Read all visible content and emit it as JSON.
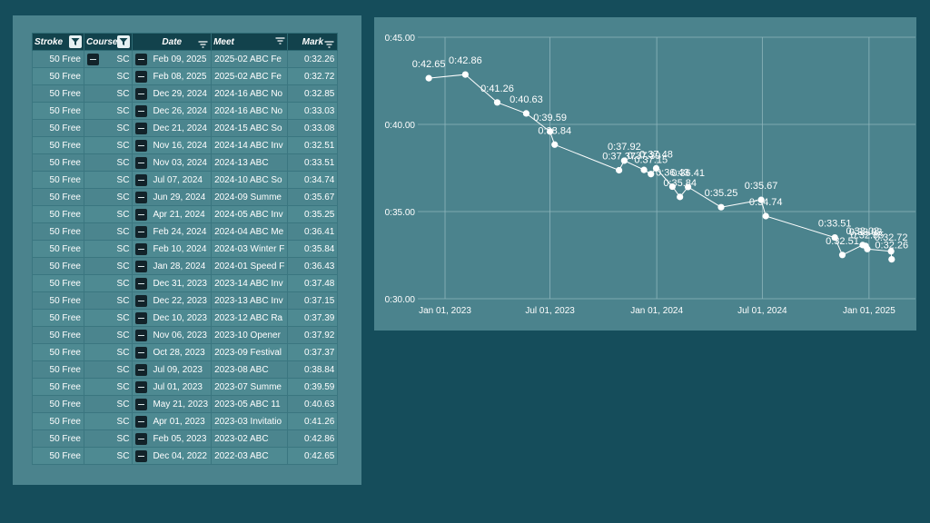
{
  "table": {
    "columns": [
      {
        "key": "stroke",
        "label": "Stroke"
      },
      {
        "key": "course",
        "label": "Course"
      },
      {
        "key": "date",
        "label": "Date"
      },
      {
        "key": "meet",
        "label": "Meet"
      },
      {
        "key": "mark",
        "label": "Mark"
      }
    ],
    "rows": [
      {
        "stroke": "50 Free",
        "course": "SC",
        "date": "Feb 09, 2025",
        "meet": "2025-02 ABC Fe",
        "mark": "0:32.26"
      },
      {
        "stroke": "50 Free",
        "course": "SC",
        "date": "Feb 08, 2025",
        "meet": "2025-02 ABC Fe",
        "mark": "0:32.72"
      },
      {
        "stroke": "50 Free",
        "course": "SC",
        "date": "Dec 29, 2024",
        "meet": "2024-16 ABC No",
        "mark": "0:32.85"
      },
      {
        "stroke": "50 Free",
        "course": "SC",
        "date": "Dec 26, 2024",
        "meet": "2024-16 ABC No",
        "mark": "0:33.03"
      },
      {
        "stroke": "50 Free",
        "course": "SC",
        "date": "Dec 21, 2024",
        "meet": "2024-15 ABC So",
        "mark": "0:33.08"
      },
      {
        "stroke": "50 Free",
        "course": "SC",
        "date": "Nov 16, 2024",
        "meet": "2024-14 ABC Inv",
        "mark": "0:32.51"
      },
      {
        "stroke": "50 Free",
        "course": "SC",
        "date": "Nov 03, 2024",
        "meet": "2024-13 ABC",
        "mark": "0:33.51"
      },
      {
        "stroke": "50 Free",
        "course": "SC",
        "date": "Jul 07, 2024",
        "meet": "2024-10 ABC So",
        "mark": "0:34.74"
      },
      {
        "stroke": "50 Free",
        "course": "SC",
        "date": "Jun 29, 2024",
        "meet": "2024-09 Summe",
        "mark": "0:35.67"
      },
      {
        "stroke": "50 Free",
        "course": "SC",
        "date": "Apr 21, 2024",
        "meet": "2024-05 ABC Inv",
        "mark": "0:35.25"
      },
      {
        "stroke": "50 Free",
        "course": "SC",
        "date": "Feb 24, 2024",
        "meet": "2024-04 ABC Me",
        "mark": "0:36.41"
      },
      {
        "stroke": "50 Free",
        "course": "SC",
        "date": "Feb 10, 2024",
        "meet": "2024-03 Winter F",
        "mark": "0:35.84"
      },
      {
        "stroke": "50 Free",
        "course": "SC",
        "date": "Jan 28, 2024",
        "meet": "2024-01 Speed F",
        "mark": "0:36.43"
      },
      {
        "stroke": "50 Free",
        "course": "SC",
        "date": "Dec 31, 2023",
        "meet": "2023-14 ABC Inv",
        "mark": "0:37.48"
      },
      {
        "stroke": "50 Free",
        "course": "SC",
        "date": "Dec 22, 2023",
        "meet": "2023-13 ABC Inv",
        "mark": "0:37.15"
      },
      {
        "stroke": "50 Free",
        "course": "SC",
        "date": "Dec 10, 2023",
        "meet": "2023-12 ABC Ra",
        "mark": "0:37.39"
      },
      {
        "stroke": "50 Free",
        "course": "SC",
        "date": "Nov 06, 2023",
        "meet": "2023-10 Opener",
        "mark": "0:37.92"
      },
      {
        "stroke": "50 Free",
        "course": "SC",
        "date": "Oct 28, 2023",
        "meet": "2023-09 Festival",
        "mark": "0:37.37"
      },
      {
        "stroke": "50 Free",
        "course": "SC",
        "date": "Jul 09, 2023",
        "meet": "2023-08 ABC",
        "mark": "0:38.84"
      },
      {
        "stroke": "50 Free",
        "course": "SC",
        "date": "Jul 01, 2023",
        "meet": "2023-07 Summe",
        "mark": "0:39.59"
      },
      {
        "stroke": "50 Free",
        "course": "SC",
        "date": "May 21, 2023",
        "meet": "2023-05 ABC 11",
        "mark": "0:40.63"
      },
      {
        "stroke": "50 Free",
        "course": "SC",
        "date": "Apr 01, 2023",
        "meet": "2023-03 Invitatio",
        "mark": "0:41.26"
      },
      {
        "stroke": "50 Free",
        "course": "SC",
        "date": "Feb 05, 2023",
        "meet": "2023-02 ABC",
        "mark": "0:42.86"
      },
      {
        "stroke": "50 Free",
        "course": "SC",
        "date": "Dec 04, 2022",
        "meet": "2022-03 ABC",
        "mark": "0:42.65"
      }
    ]
  },
  "icons": {
    "filter": "filter-icon",
    "sort": "sort-lines-icon",
    "row_button": "minus-box-icon"
  },
  "colors": {
    "background": "#154d5b",
    "panel": "#4b838d",
    "header": "#12424c",
    "text": "#ffffff",
    "grid": "#8fb6bc"
  },
  "chart_data": {
    "type": "line",
    "ylim": [
      "0:30.00",
      "0:45.00"
    ],
    "y_ticks": [
      "0:30.00",
      "0:35.00",
      "0:40.00",
      "0:45.00"
    ],
    "x_ticks": [
      "Jan 01, 2023",
      "Jul 01, 2023",
      "Jan 01, 2024",
      "Jul 01, 2024",
      "Jan 01, 2025"
    ],
    "xlim": [
      "2022-11-15",
      "2025-02-25"
    ],
    "grid": true,
    "series": [
      {
        "points": [
          {
            "x": "2022-12-04",
            "y": 42.65,
            "label": "0:42.65"
          },
          {
            "x": "2023-02-05",
            "y": 42.86,
            "label": "0:42.86"
          },
          {
            "x": "2023-04-01",
            "y": 41.26,
            "label": "0:41.26"
          },
          {
            "x": "2023-05-21",
            "y": 40.63,
            "label": "0:40.63"
          },
          {
            "x": "2023-07-01",
            "y": 39.59,
            "label": "0:39.59"
          },
          {
            "x": "2023-07-09",
            "y": 38.84,
            "label": "0:38.84"
          },
          {
            "x": "2023-10-28",
            "y": 37.37,
            "label": "0:37.37"
          },
          {
            "x": "2023-11-06",
            "y": 37.92,
            "label": "0:37.92"
          },
          {
            "x": "2023-12-10",
            "y": 37.39,
            "label": "0:37.39"
          },
          {
            "x": "2023-12-22",
            "y": 37.15,
            "label": "0:37.15"
          },
          {
            "x": "2023-12-31",
            "y": 37.48,
            "label": "0:37.48"
          },
          {
            "x": "2024-01-28",
            "y": 36.43,
            "label": "0:36.43"
          },
          {
            "x": "2024-02-10",
            "y": 35.84,
            "label": "0:35.84"
          },
          {
            "x": "2024-02-24",
            "y": 36.41,
            "label": "0:36.41"
          },
          {
            "x": "2024-04-21",
            "y": 35.25,
            "label": "0:35.25"
          },
          {
            "x": "2024-06-29",
            "y": 35.67,
            "label": "0:35.67"
          },
          {
            "x": "2024-07-07",
            "y": 34.74,
            "label": "0:34.74"
          },
          {
            "x": "2024-11-03",
            "y": 33.51,
            "label": "0:33.51"
          },
          {
            "x": "2024-11-16",
            "y": 32.51,
            "label": "0:32.51"
          },
          {
            "x": "2024-12-21",
            "y": 33.08,
            "label": "0:33.08"
          },
          {
            "x": "2024-12-26",
            "y": 33.03,
            "label": "0:33.03"
          },
          {
            "x": "2024-12-29",
            "y": 32.85,
            "label": "0:32.85"
          },
          {
            "x": "2025-02-08",
            "y": 32.72,
            "label": "0:32.72"
          },
          {
            "x": "2025-02-09",
            "y": 32.26,
            "label": "0:32.26"
          }
        ]
      }
    ]
  }
}
